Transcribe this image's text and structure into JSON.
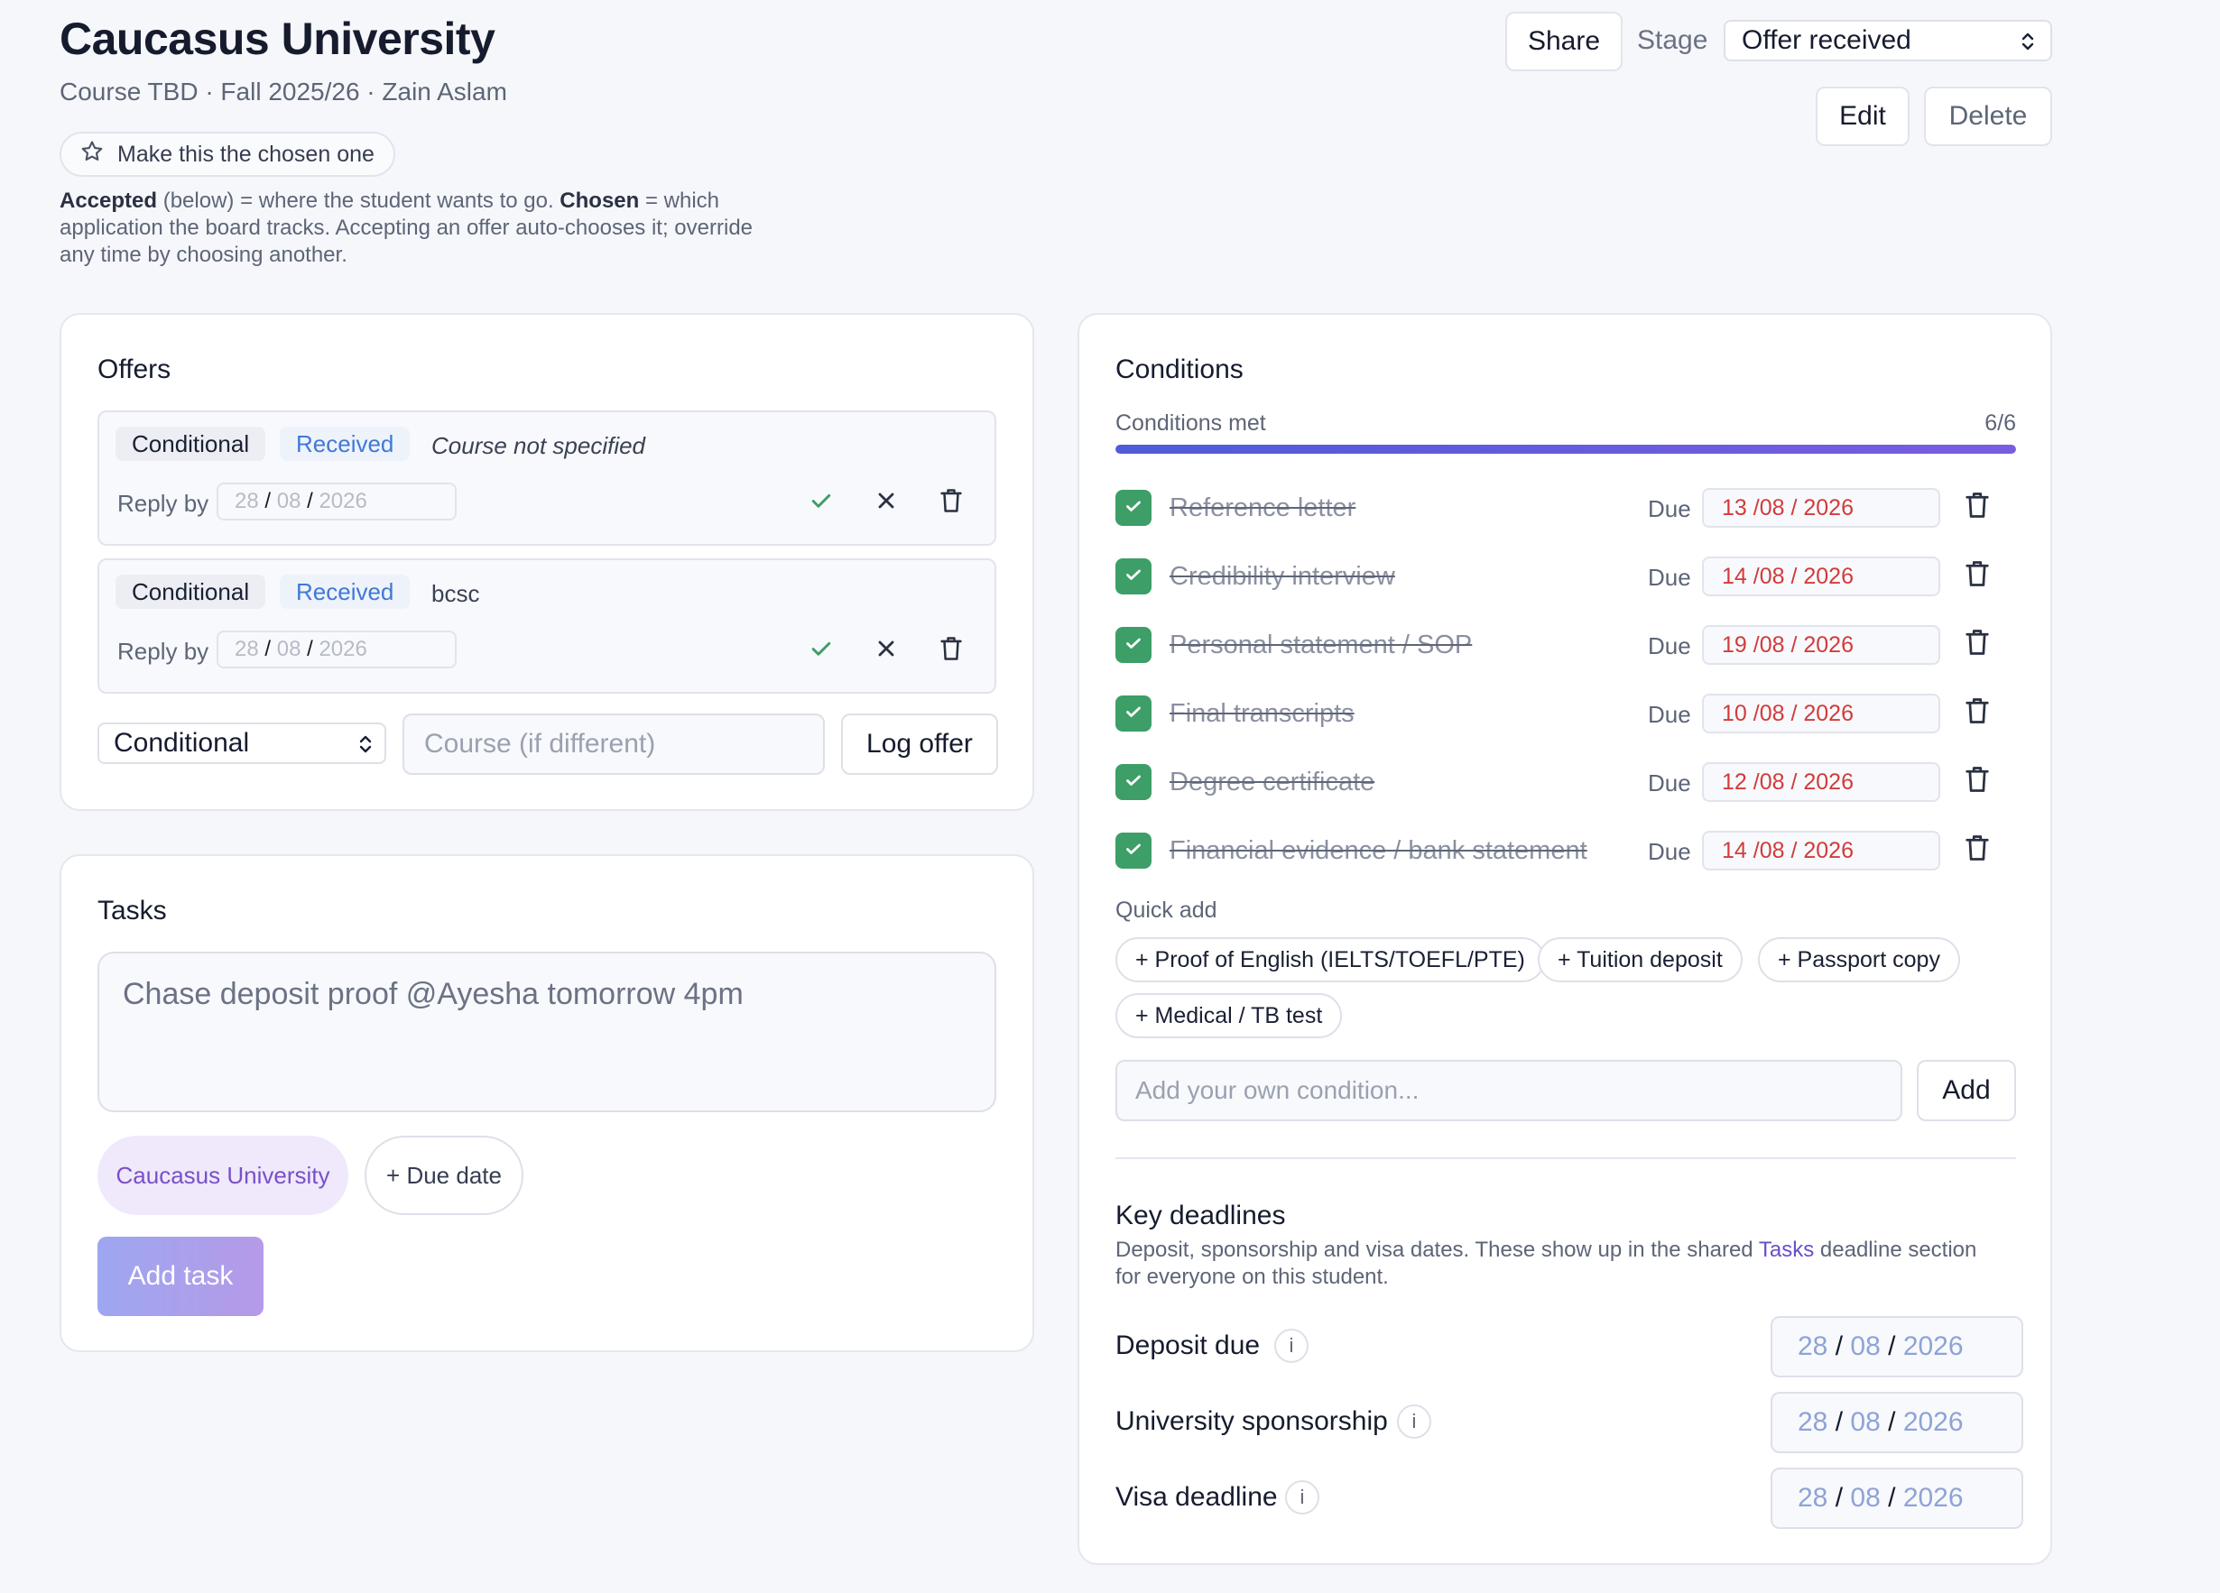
{
  "header": {
    "title": "Caucasus University",
    "subtitle": "Course TBD · Fall 2025/26 · Zain Aslam",
    "chosen_button": "Make this the chosen one",
    "help": {
      "accepted_bold": "Accepted",
      "accepted_text": " (below) = where the student wants to go. ",
      "chosen_bold": "Chosen",
      "chosen_text": " = which application the board tracks. Accepting an offer auto-chooses it; override any time by choosing another."
    },
    "share_label": "Share",
    "stage_label": "Stage",
    "stage_value": "Offer received",
    "edit_label": "Edit",
    "delete_label": "Delete"
  },
  "offers": {
    "title": "Offers",
    "items": [
      {
        "type": "Conditional",
        "status": "Received",
        "course": "Course not specified",
        "reply_label": "Reply by",
        "reply_date": {
          "dd": "28",
          "mm": "08",
          "yyyy": "2026"
        }
      },
      {
        "type": "Conditional",
        "status": "Received",
        "course": "bcsc",
        "reply_label": "Reply by",
        "reply_date": {
          "dd": "28",
          "mm": "08",
          "yyyy": "2026"
        }
      }
    ],
    "new_offer": {
      "type_value": "Conditional",
      "course_placeholder": "Course (if different)",
      "log_label": "Log offer"
    }
  },
  "tasks": {
    "title": "Tasks",
    "input_text": "Chase deposit proof @Ayesha tomorrow 4pm",
    "chip_university": "Caucasus University",
    "chip_due": "+ Due date",
    "add_label": "Add task"
  },
  "conditions": {
    "title": "Conditions",
    "met_label": "Conditions met",
    "met_count": "6/6",
    "progress_fraction": 1.0,
    "due_label": "Due",
    "items": [
      {
        "name": "Reference letter",
        "dd": "13",
        "mm": "08",
        "yyyy": "2026"
      },
      {
        "name": "Credibility interview",
        "dd": "14",
        "mm": "08",
        "yyyy": "2026"
      },
      {
        "name": "Personal statement / SOP",
        "dd": "19",
        "mm": "08",
        "yyyy": "2026"
      },
      {
        "name": "Final transcripts",
        "dd": "10",
        "mm": "08",
        "yyyy": "2026"
      },
      {
        "name": "Degree certificate",
        "dd": "12",
        "mm": "08",
        "yyyy": "2026"
      },
      {
        "name": "Financial evidence / bank statement",
        "dd": "14",
        "mm": "08",
        "yyyy": "2026"
      }
    ],
    "quick_add_label": "Quick add",
    "quick_add": [
      "+ Proof of English (IELTS/TOEFL/PTE)",
      "+ Tuition deposit",
      "+ Passport copy",
      "+ Medical / TB test"
    ],
    "own_placeholder": "Add your own condition...",
    "add_label": "Add"
  },
  "key_deadlines": {
    "title": "Key deadlines",
    "desc_before": "Deposit, sponsorship and visa dates. These show up in the shared ",
    "desc_link": "Tasks",
    "desc_after": " deadline section for everyone on this student.",
    "info_glyph": "i",
    "items": [
      {
        "label": "Deposit due",
        "dd": "28",
        "mm": "08",
        "yyyy": "2026"
      },
      {
        "label": "University sponsorship",
        "dd": "28",
        "mm": "08",
        "yyyy": "2026"
      },
      {
        "label": "Visa deadline",
        "dd": "28",
        "mm": "08",
        "yyyy": "2026"
      }
    ]
  },
  "colors": {
    "accent": "#5b5fd9",
    "success": "#3d9e67",
    "danger": "#d23b3b",
    "received": "#3f79d6",
    "chip_purple": "#7a50c8"
  },
  "icons": {
    "star": "star-icon",
    "accept": "check-icon",
    "reject": "close-icon",
    "delete": "trash-icon",
    "select": "updown-chevron-icon",
    "info": "info-icon"
  }
}
